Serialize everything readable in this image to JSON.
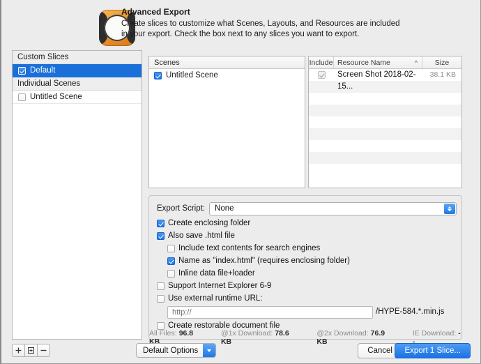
{
  "header": {
    "icon": "hype-app-icon",
    "title": "Advanced Export",
    "description": "Create slices to customize what Scenes, Layouts, and Resources are included in your export. Check the box next to any slices you want to export."
  },
  "sidebar": {
    "groups": [
      {
        "label": "Custom Slices"
      },
      {
        "label": "Individual Scenes"
      }
    ],
    "items": [
      {
        "label": "Default",
        "checked": true,
        "selected": true
      },
      {
        "label": "Untitled Scene",
        "checked": false,
        "selected": false
      }
    ],
    "buttons": [
      {
        "name": "add-slice-button",
        "glyph": "plus-icon"
      },
      {
        "name": "duplicate-slice-button",
        "glyph": "duplicate-icon"
      },
      {
        "name": "remove-slice-button",
        "glyph": "minus-icon"
      }
    ]
  },
  "scenes": {
    "header": "Scenes",
    "rows": [
      {
        "label": "Untitled Scene",
        "checked": true
      }
    ]
  },
  "resources": {
    "columns": {
      "include": "Include",
      "name": "Resource Name",
      "size": "Size",
      "sort": "^"
    },
    "rows": [
      {
        "include": true,
        "name": "Screen Shot 2018-02-15...",
        "size": "38.1 KB"
      }
    ],
    "empty_row_count": 6
  },
  "options": {
    "export_script_label": "Export Script:",
    "export_script_value": "None",
    "checkboxes": [
      {
        "label": "Create enclosing folder",
        "checked": true,
        "indent": 0
      },
      {
        "label": "Also save .html file",
        "checked": true,
        "indent": 0
      },
      {
        "label": "Include text contents for search engines",
        "checked": false,
        "indent": 1
      },
      {
        "label": "Name as \"index.html\" (requires enclosing folder)",
        "checked": true,
        "indent": 1
      },
      {
        "label": "Inline data file+loader",
        "checked": false,
        "indent": 1
      },
      {
        "label": "Support Internet Explorer 6-9",
        "checked": false,
        "indent": 0
      },
      {
        "label": "Use external runtime URL:",
        "checked": false,
        "indent": 0
      }
    ],
    "url_field": {
      "value": "",
      "placeholder": "http://"
    },
    "url_suffix": "/HYPE-584.*.min.js",
    "restorable": {
      "label": "Create restorable document file",
      "checked": false
    },
    "stats": [
      {
        "label": "All Files:",
        "value": "96.8 KB"
      },
      {
        "label": "@1x Download:",
        "value": "78.6 KB"
      },
      {
        "label": "@2x Download:",
        "value": "76.9 KB"
      },
      {
        "label": "IE Download:",
        "value": "--"
      }
    ]
  },
  "footer": {
    "default_options": "Default Options",
    "cancel": "Cancel",
    "export": "Export 1 Slice..."
  },
  "colors": {
    "accent_blue": "#1a72e3",
    "selection_blue": "#1a6fd8",
    "dialog_bg": "#ececec",
    "panel_bg": "#ffffff"
  }
}
